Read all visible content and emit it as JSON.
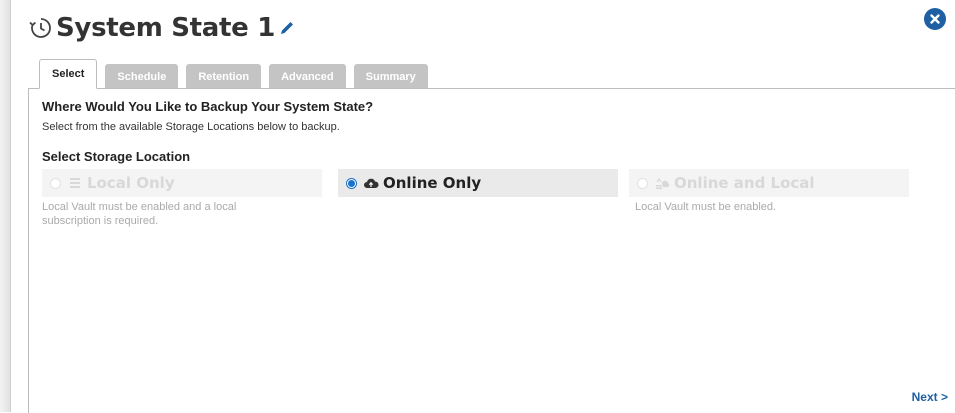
{
  "dialog": {
    "title": "System State 1",
    "close_label": "close"
  },
  "tabs": [
    {
      "label": "Select",
      "active": true
    },
    {
      "label": "Schedule",
      "active": false
    },
    {
      "label": "Retention",
      "active": false
    },
    {
      "label": "Advanced",
      "active": false
    },
    {
      "label": "Summary",
      "active": false
    }
  ],
  "content": {
    "heading": "Where Would You Like to Backup Your System State?",
    "subheading": "Select from the available Storage Locations below to backup.",
    "section_label": "Select Storage Location",
    "options": [
      {
        "label": "Local Only",
        "note_line1": "Local Vault must be enabled and a local",
        "note_line2": "subscription is required.",
        "selected": false,
        "icon": "server-icon"
      },
      {
        "label": "Online Only",
        "note_line1": "",
        "note_line2": "",
        "selected": true,
        "icon": "cloud-icon"
      },
      {
        "label": "Online and Local",
        "note_line1": "Local Vault must be enabled.",
        "note_line2": "",
        "selected": false,
        "icon": "sync-icon"
      }
    ]
  },
  "footer": {
    "next_label": "Next >"
  },
  "colors": {
    "accent": "#1f5fa3",
    "radio_selected": "#1a73c8",
    "tab_inactive": "#c4c4c4",
    "disabled_text": "#d8d8d8"
  }
}
